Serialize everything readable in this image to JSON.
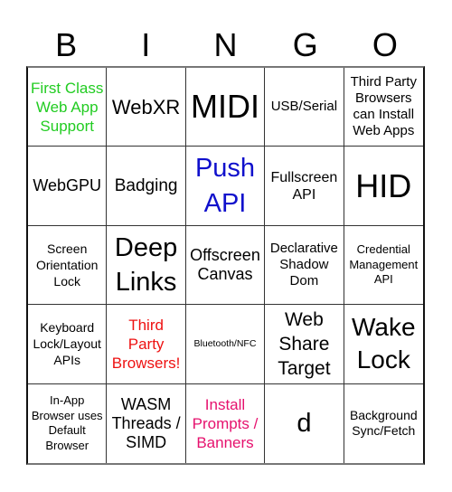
{
  "header": {
    "letters": [
      "B",
      "I",
      "N",
      "G",
      "O"
    ]
  },
  "colors": {
    "green": "#22cc22",
    "blue": "#1010cc",
    "red": "#ee1111",
    "pink": "#e6126e",
    "black": "#000000"
  },
  "board": {
    "cells": [
      {
        "text": "First Class Web App Support",
        "color": "#22cc22"
      },
      {
        "text": "WebXR",
        "color": "#000000"
      },
      {
        "text": "MIDI",
        "color": "#000000"
      },
      {
        "text": "USB/Serial",
        "color": "#000000"
      },
      {
        "text": "Third Party Browsers can Install Web Apps",
        "color": "#000000"
      },
      {
        "text": "WebGPU",
        "color": "#000000"
      },
      {
        "text": "Badging",
        "color": "#000000"
      },
      {
        "text": "Push API",
        "color": "#1010cc"
      },
      {
        "text": "Fullscreen API",
        "color": "#000000"
      },
      {
        "text": "HID",
        "color": "#000000"
      },
      {
        "text": "Screen Orientation Lock",
        "color": "#000000"
      },
      {
        "text": "Deep Links",
        "color": "#000000"
      },
      {
        "text": "Offscreen Canvas",
        "color": "#000000"
      },
      {
        "text": "Declarative Shadow Dom",
        "color": "#000000"
      },
      {
        "text": "Credential Management API",
        "color": "#000000"
      },
      {
        "text": "Keyboard Lock/Layout APIs",
        "color": "#000000"
      },
      {
        "text": "Third Party Browsers!",
        "color": "#ee1111"
      },
      {
        "text": "Bluetooth/NFC",
        "color": "#000000"
      },
      {
        "text": "Web Share Target",
        "color": "#000000"
      },
      {
        "text": "Wake Lock",
        "color": "#000000"
      },
      {
        "text": "In-App Browser uses Default Browser",
        "color": "#000000"
      },
      {
        "text": "WASM Threads / SIMD",
        "color": "#000000"
      },
      {
        "text": "Install Prompts / Banners",
        "color": "#e6126e"
      },
      {
        "text": "d",
        "color": "#000000"
      },
      {
        "text": "Background Sync/Fetch",
        "color": "#000000"
      }
    ]
  }
}
